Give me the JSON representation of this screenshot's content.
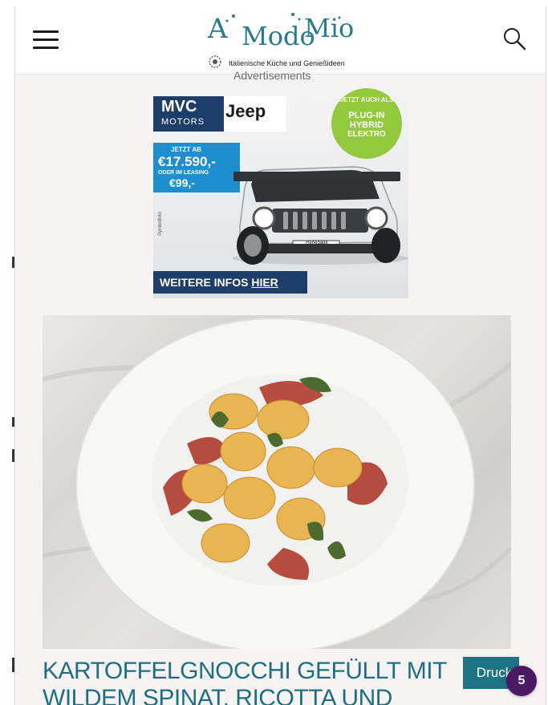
{
  "header": {
    "menu_icon": "hamburger-icon",
    "search_icon": "search-icon",
    "logo": {
      "word1": "A",
      "word2": "Modo",
      "word3": "Mio",
      "tagline": "Italienische Küche und Genießideen"
    }
  },
  "advertisement": {
    "label": "Advertisements",
    "brand1": "MVC",
    "brand1_sub": "MOTORS",
    "brand2": "Jeep",
    "price_from_label": "JETZT AB",
    "price": "€17.590,-",
    "leasing_label": "ODER IM LEASING",
    "leasing_price": "€99,-",
    "badge_line1": "JETZT AUCH ALS",
    "badge_line2": "PLUG-IN HYBRID",
    "badge_line3": "ELEKTRO",
    "cta_prefix": "WEITERE INFOS ",
    "cta_link": "HIER",
    "car_plate": "Renegade",
    "fine_print": "Symbolfoto"
  },
  "recipe": {
    "title": "KARTOFFELGNOCCHI GEFÜLLT MIT WILDEM SPINAT, RICOTTA UND",
    "print_label": "Druck"
  },
  "notification": {
    "count": "5"
  },
  "colors": {
    "accent": "#1f6f83",
    "print_button": "#1e7385",
    "notification": "#4a1a63",
    "ad_navy": "#1d3d6b",
    "ad_blue": "#1d8fd1",
    "ad_green": "#93c93c"
  }
}
